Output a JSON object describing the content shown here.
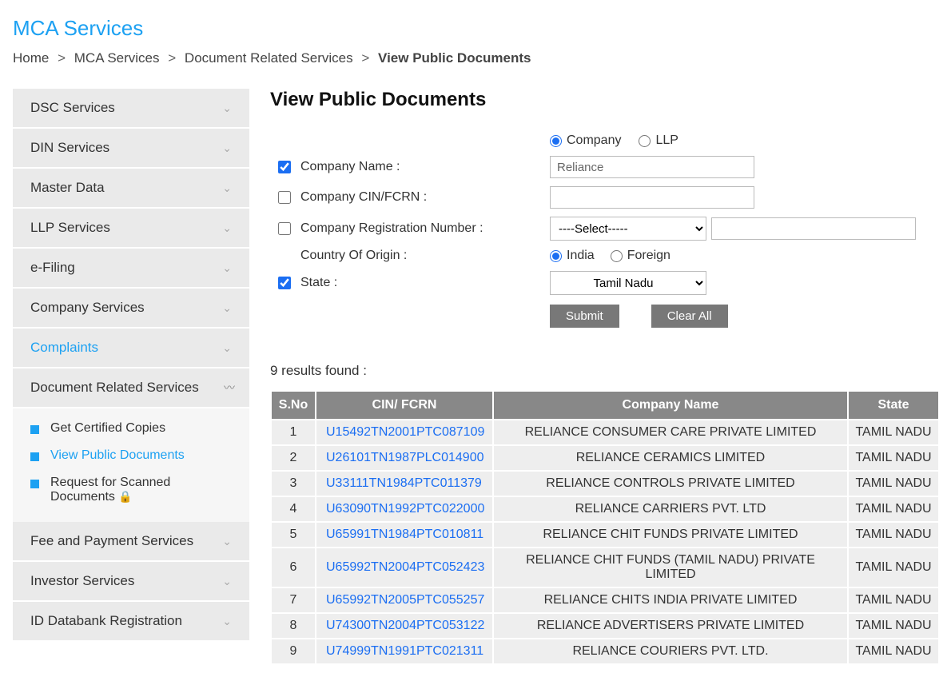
{
  "page_title": "MCA Services",
  "breadcrumb": {
    "home": "Home",
    "a": "MCA Services",
    "b": "Document Related Services",
    "c": "View Public Documents",
    "sep": ">"
  },
  "sidebar": {
    "items": [
      "DSC Services",
      "DIN Services",
      "Master Data",
      "LLP Services",
      "e-Filing",
      "Company Services",
      "Complaints",
      "Document Related Services",
      "Fee and Payment Services",
      "Investor Services",
      "ID Databank Registration"
    ],
    "sub": [
      "Get Certified Copies",
      "View Public Documents",
      "Request for Scanned Documents"
    ]
  },
  "main": {
    "heading": "View Public Documents",
    "type": {
      "company": "Company",
      "llp": "LLP"
    },
    "labels": {
      "name": "Company Name :",
      "cin": "Company CIN/FCRN :",
      "regno": "Company Registration Number :",
      "country": "Country Of Origin :",
      "state": "State :"
    },
    "inputs": {
      "name_value": "Reliance",
      "regno_select": "----Select-----",
      "country_india": "India",
      "country_foreign": "Foreign",
      "state_value": "Tamil Nadu"
    },
    "buttons": {
      "submit": "Submit",
      "clear": "Clear All"
    },
    "results_info": "9  results found :",
    "th": {
      "sn": "S.No",
      "cin": "CIN/ FCRN",
      "name": "Company Name",
      "state": "State"
    },
    "rows": [
      {
        "sn": "1",
        "cin": "U15492TN2001PTC087109",
        "name": "RELIANCE CONSUMER CARE PRIVATE LIMITED",
        "state": "TAMIL NADU"
      },
      {
        "sn": "2",
        "cin": "U26101TN1987PLC014900",
        "name": "RELIANCE CERAMICS LIMITED",
        "state": "TAMIL NADU"
      },
      {
        "sn": "3",
        "cin": "U33111TN1984PTC011379",
        "name": "RELIANCE CONTROLS PRIVATE LIMITED",
        "state": "TAMIL NADU"
      },
      {
        "sn": "4",
        "cin": "U63090TN1992PTC022000",
        "name": "RELIANCE CARRIERS PVT. LTD",
        "state": "TAMIL NADU"
      },
      {
        "sn": "5",
        "cin": "U65991TN1984PTC010811",
        "name": "RELIANCE CHIT FUNDS PRIVATE LIMITED",
        "state": "TAMIL NADU"
      },
      {
        "sn": "6",
        "cin": "U65992TN2004PTC052423",
        "name": "RELIANCE CHIT FUNDS (TAMIL NADU) PRIVATE LIMITED",
        "state": "TAMIL NADU"
      },
      {
        "sn": "7",
        "cin": "U65992TN2005PTC055257",
        "name": "RELIANCE CHITS INDIA PRIVATE LIMITED",
        "state": "TAMIL NADU"
      },
      {
        "sn": "8",
        "cin": "U74300TN2004PTC053122",
        "name": "RELIANCE ADVERTISERS PRIVATE LIMITED",
        "state": "TAMIL NADU"
      },
      {
        "sn": "9",
        "cin": "U74999TN1991PTC021311",
        "name": "RELIANCE COURIERS PVT. LTD.",
        "state": "TAMIL NADU"
      }
    ]
  }
}
